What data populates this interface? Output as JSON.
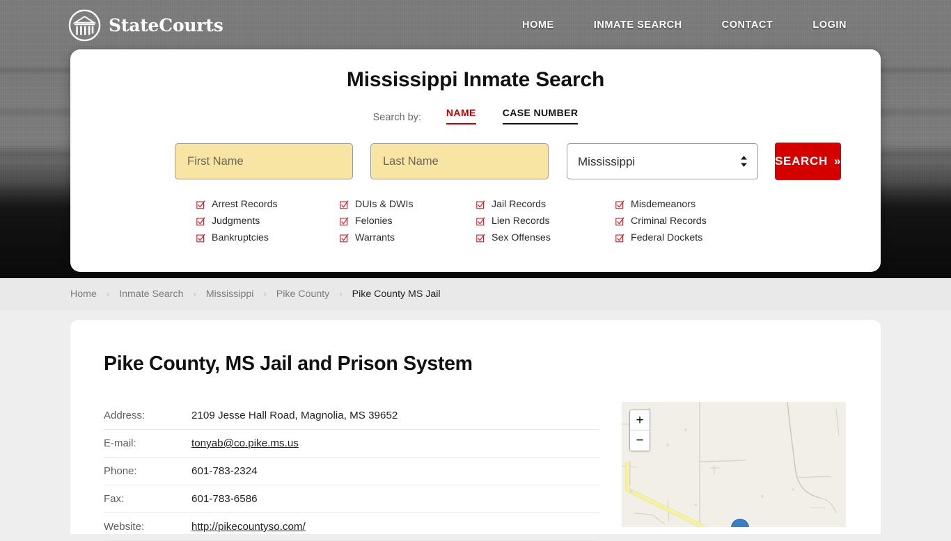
{
  "hero": {
    "background_word": "COURTHOUSE",
    "overlay_color": "#6f6f6f"
  },
  "header": {
    "logo_icon": "courthouse-circle-icon",
    "brand": "StateCourts",
    "nav": [
      {
        "label": "HOME"
      },
      {
        "label": "INMATE SEARCH"
      },
      {
        "label": "CONTACT"
      },
      {
        "label": "LOGIN"
      }
    ]
  },
  "search": {
    "title": "Mississippi Inmate Search",
    "search_by_label": "Search by:",
    "tabs": [
      {
        "label": "NAME",
        "active": true,
        "color": "#c40000"
      },
      {
        "label": "CASE NUMBER",
        "active": false,
        "color": "#111111"
      }
    ],
    "first_name_placeholder": "First Name",
    "first_name_value": "",
    "last_name_placeholder": "Last Name",
    "last_name_value": "",
    "state_selected": "Mississippi",
    "state_options": [
      "Mississippi"
    ],
    "button_label": "SEARCH",
    "button_chevron": "»",
    "button_color": "#d40000",
    "field_color": "#f8e5a4",
    "record_types": [
      "Arrest Records",
      "DUIs & DWIs",
      "Jail Records",
      "Misdemeanors",
      "Judgments",
      "Felonies",
      "Lien Records",
      "Criminal Records",
      "Bankruptcies",
      "Warrants",
      "Sex Offenses",
      "Federal Dockets"
    ],
    "checkbox_color": "#c4262e"
  },
  "breadcrumb": {
    "separator": "›",
    "items": [
      {
        "label": "Home",
        "current": false
      },
      {
        "label": "Inmate Search",
        "current": false
      },
      {
        "label": "Mississippi",
        "current": false
      },
      {
        "label": "Pike County",
        "current": false
      },
      {
        "label": "Pike County MS Jail",
        "current": true
      }
    ]
  },
  "main": {
    "title": "Pike County, MS Jail and Prison System",
    "details": [
      {
        "key": "Address:",
        "value": "2109 Jesse Hall Road, Magnolia, MS 39652",
        "link": false
      },
      {
        "key": "E-mail:",
        "value": "tonyab@co.pike.ms.us",
        "link": true
      },
      {
        "key": "Phone:",
        "value": "601-783-2324",
        "link": false
      },
      {
        "key": "Fax:",
        "value": "601-783-6586",
        "link": false
      },
      {
        "key": "Website:",
        "value": "http://pikecountyso.com/",
        "link": true
      }
    ]
  },
  "map": {
    "zoom_in_label": "+",
    "zoom_out_label": "−",
    "background_color": "#f2efe9",
    "highway_color": "#f5ee9c",
    "marker_color": "#3b7ec4"
  }
}
